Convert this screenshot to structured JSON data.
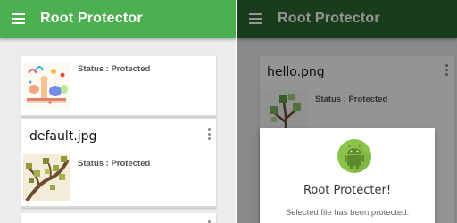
{
  "left_screen": {
    "app_title": "Root Protector",
    "files": [
      {
        "name": "",
        "status": "Status : Protected"
      },
      {
        "name": "default.jpg",
        "status": "Status : Protected"
      }
    ]
  },
  "right_screen": {
    "app_title": "Root Protector",
    "files": [
      {
        "name": "hello.png",
        "status": "Status : Protected"
      }
    ],
    "dialog": {
      "title": "Root Protecter!",
      "message": "Selected file has been protected."
    }
  },
  "colors": {
    "app_bar": "#4caf50",
    "app_bar_dimmed": "#2c6a2f",
    "android_green": "#8bc34a"
  }
}
